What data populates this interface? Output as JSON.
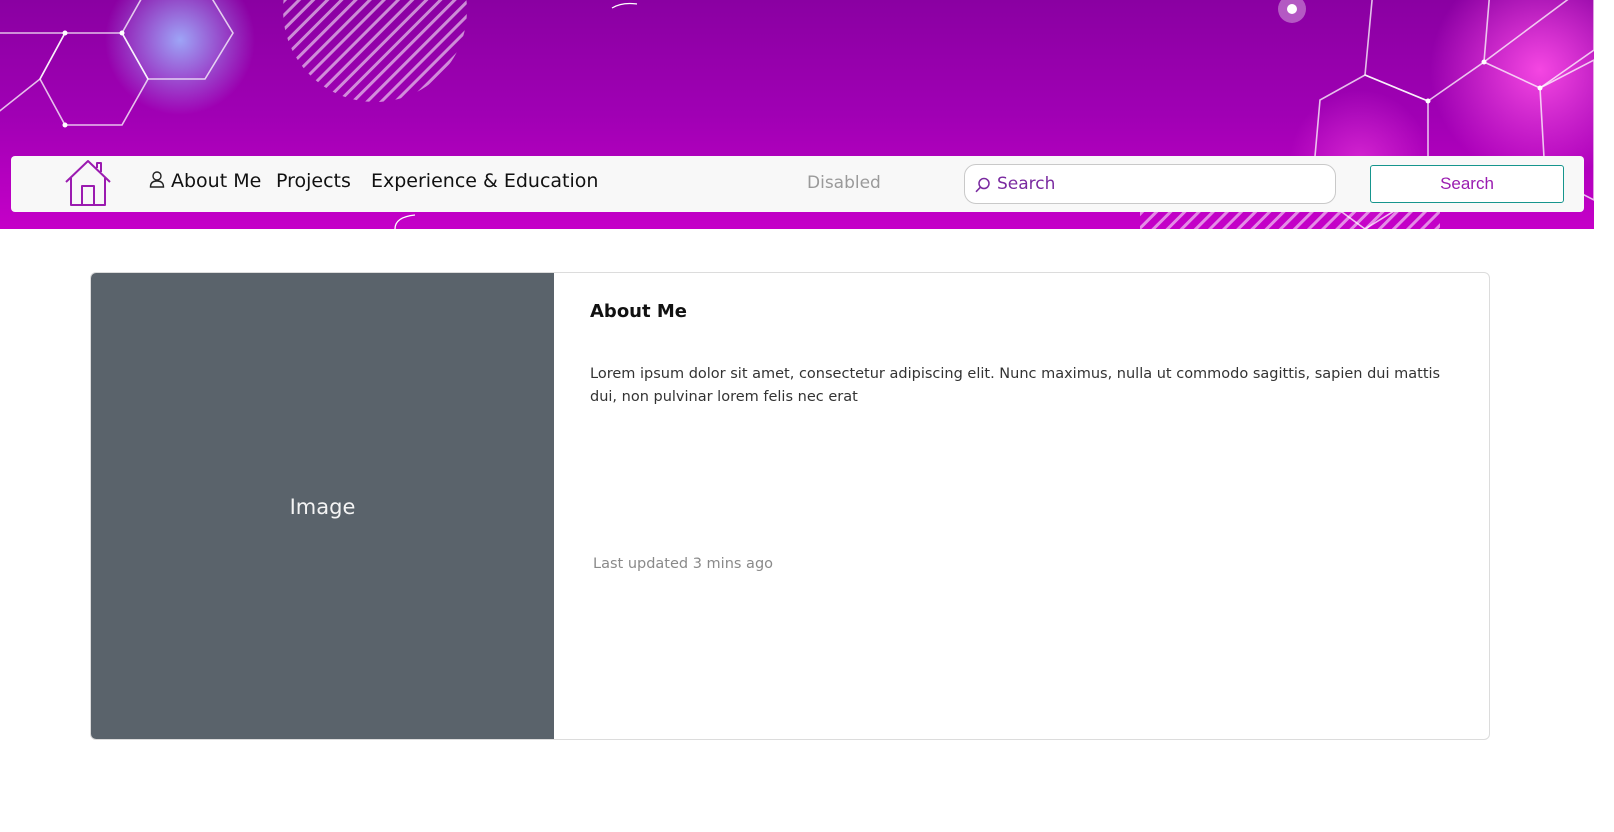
{
  "nav": {
    "home_icon": "house-icon",
    "about_icon": "person-icon",
    "about_label": "About Me",
    "projects_label": "Projects",
    "experience_label": "Experience & Education",
    "disabled_label": "Disabled",
    "search_placeholder": "Search",
    "search_button_label": "Search"
  },
  "card": {
    "image_label": "Image",
    "title": "About Me",
    "text": "Lorem ipsum dolor sit amet, consectetur adipiscing elit. Nunc maximus, nulla ut commodo sagittis, sapien dui mattis dui, non pulvinar lorem felis nec erat",
    "updated": "Last updated 3 mins ago"
  },
  "colors": {
    "banner_top": "#8a00a2",
    "banner_bottom": "#c500c8",
    "accent_purple": "#9a1cb0",
    "button_border": "#16958d",
    "image_bg": "#5a636b"
  }
}
